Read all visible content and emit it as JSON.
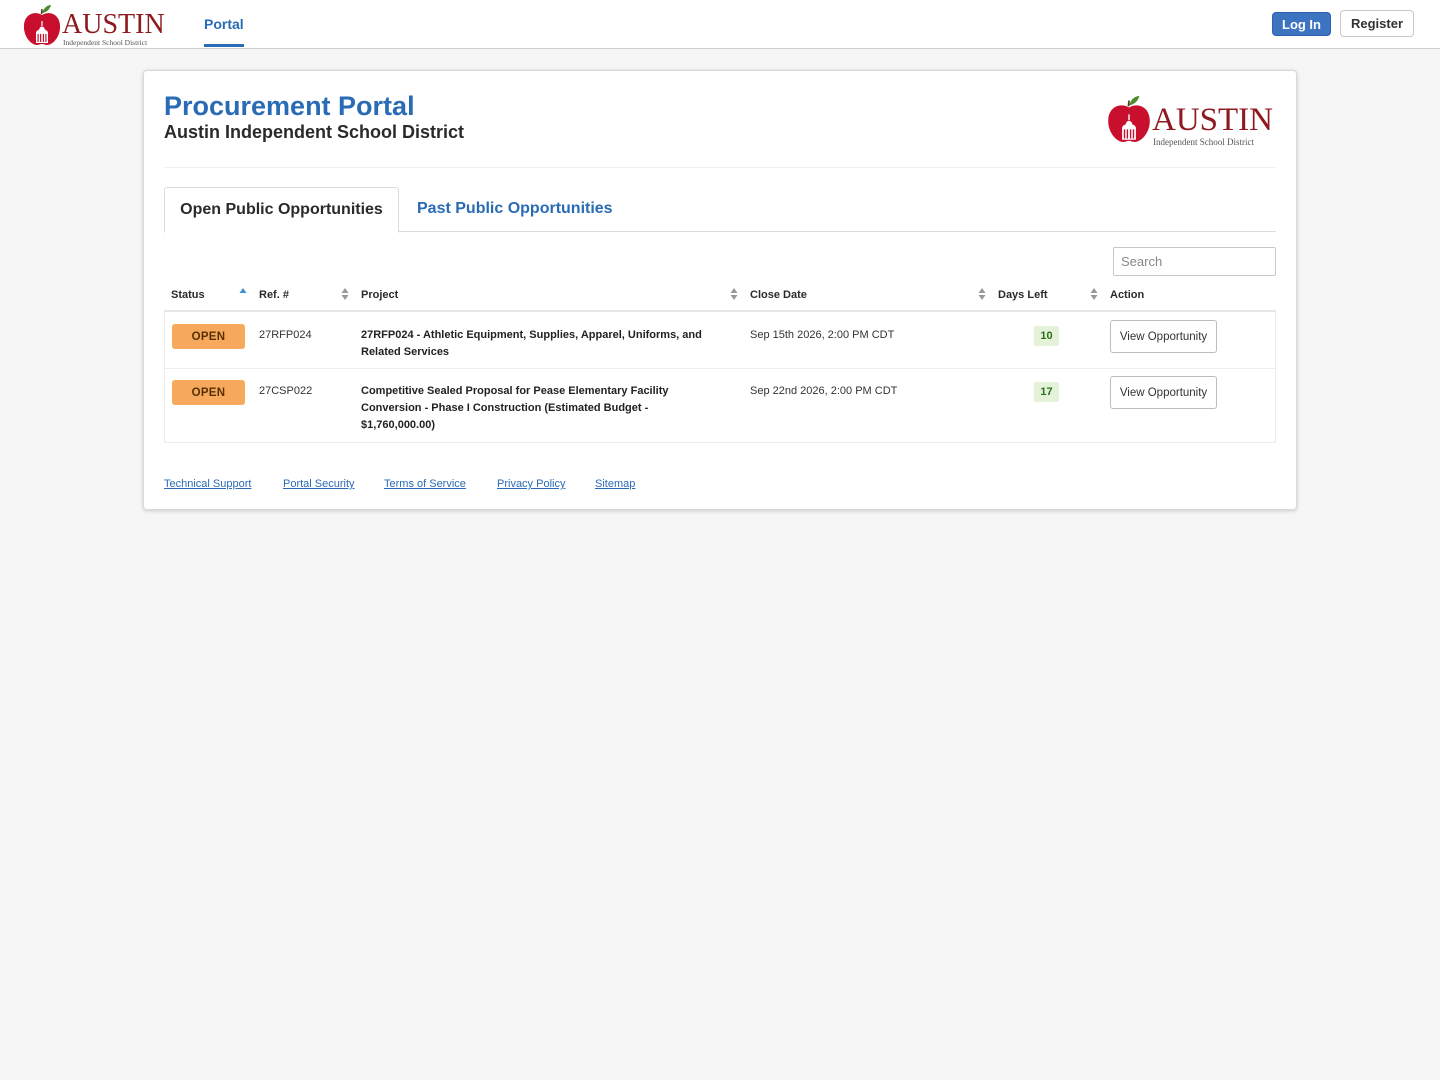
{
  "brand": {
    "wordmark": "AUSTIN",
    "subtitle": "Independent School District",
    "colors": {
      "maroon": "#8e1a20",
      "apple_red": "#c8102e",
      "leaf_green": "#4b8a2f"
    }
  },
  "nav": {
    "portal_label": "Portal",
    "login_label": "Log In",
    "register_label": "Register"
  },
  "header": {
    "title": "Procurement Portal",
    "subtitle": "Austin Independent School District"
  },
  "tabs": [
    {
      "label": "Open Public Opportunities",
      "active": true
    },
    {
      "label": "Past Public Opportunities",
      "active": false
    }
  ],
  "search": {
    "placeholder": "Search",
    "value": ""
  },
  "table": {
    "columns": [
      "Status",
      "Ref. #",
      "Project",
      "Close Date",
      "Days Left",
      "Action"
    ],
    "rows": [
      {
        "status": "OPEN",
        "ref": "27RFP024",
        "project": "27RFP024 - Athletic Equipment, Supplies, Apparel, Uniforms, and Related Services",
        "close_date": "Sep 15th 2026, 2:00 PM CDT",
        "days_left": "10",
        "action": "View Opportunity"
      },
      {
        "status": "OPEN",
        "ref": "27CSP022",
        "project": "Competitive Sealed Proposal for Pease Elementary Facility Conversion - Phase I Construction (Estimated Budget - $1,760,000.00)",
        "close_date": "Sep 22nd 2026, 2:00 PM CDT",
        "days_left": "17",
        "action": "View Opportunity"
      }
    ]
  },
  "footer": {
    "links": [
      "Technical Support",
      "Portal Security",
      "Terms of Service",
      "Privacy Policy",
      "Sitemap"
    ]
  },
  "colors": {
    "primary_blue": "#2a6bb5",
    "login_button": "#3d74c2",
    "open_badge": "#f6a95c",
    "days_left_bg": "#e3f2d8",
    "page_bg": "#f6f6f6"
  }
}
